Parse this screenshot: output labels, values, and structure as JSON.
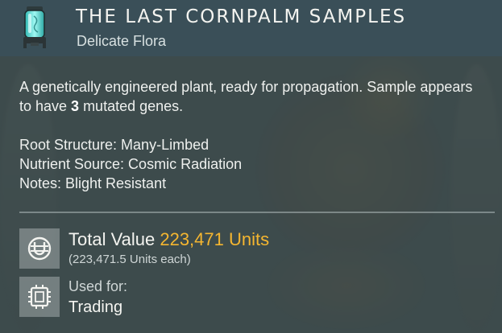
{
  "item": {
    "title": "THE LAST CORNPALM SAMPLES",
    "subtitle": "Delicate Flora"
  },
  "description": {
    "before": "A genetically engineered plant, ready for propagation. Sample appears to have ",
    "count": "3",
    "after": " mutated genes."
  },
  "properties": [
    "Root Structure: Many-Limbed",
    "Nutrient Source: Cosmic Radiation",
    "Notes: Blight Resistant"
  ],
  "value": {
    "label": "Total Value",
    "amount": "223,471 Units",
    "each": "(223,471.5 Units each)"
  },
  "usage": {
    "label": "Used for:",
    "value": "Trading"
  },
  "icons": {
    "item": "specimen-tube-icon",
    "value": "units-currency-icon",
    "usage": "trade-chip-icon"
  },
  "colors": {
    "value_accent": "#f5b630",
    "header_bg": "#3a505a",
    "tube_glow": "#5fe8e0"
  }
}
